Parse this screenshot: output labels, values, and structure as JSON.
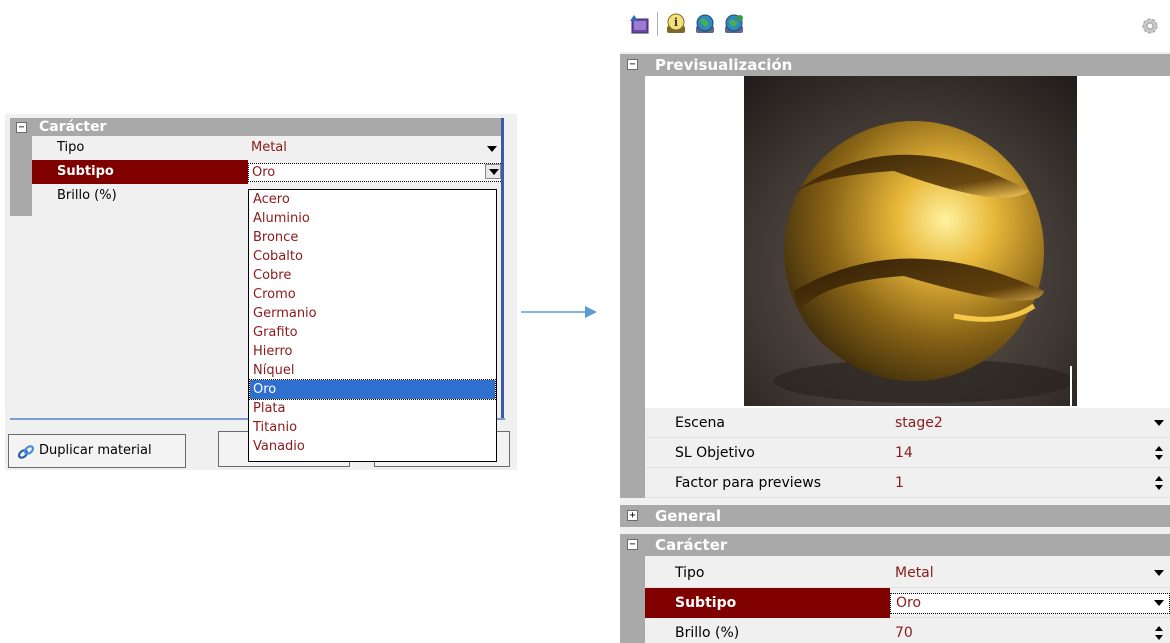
{
  "left": {
    "section_title": "Carácter",
    "collapse_glyph": "−",
    "rows": [
      {
        "label": "Tipo",
        "value": "Metal"
      },
      {
        "label": "Subtipo",
        "value": "Oro"
      },
      {
        "label": "Brillo (%)",
        "value": ""
      }
    ],
    "dropdown_options": [
      "Acero",
      "Aluminio",
      "Bronce",
      "Cobalto",
      "Cobre",
      "Cromo",
      "Germanio",
      "Grafito",
      "Hierro",
      "Níquel",
      "Oro",
      "Plata",
      "Titanio",
      "Vanadio"
    ],
    "selected_option": "Oro",
    "duplicate_button_label": "Duplicar material"
  },
  "right": {
    "toolbar_icons": [
      "import-icon",
      "info-icon",
      "globe-icon",
      "globe-refresh-icon",
      "settings-gear-icon"
    ],
    "preview": {
      "section_title": "Previsualización",
      "collapse_glyph": "−",
      "rows": [
        {
          "label": "Escena",
          "value": "stage2",
          "control": "dropdown"
        },
        {
          "label": "SL Objetivo",
          "value": "14",
          "control": "spinner"
        },
        {
          "label": "Factor para previews",
          "value": "1",
          "control": "spinner"
        }
      ]
    },
    "general": {
      "section_title": "General",
      "collapse_glyph": "+"
    },
    "caracter": {
      "section_title": "Carácter",
      "collapse_glyph": "−",
      "rows": [
        {
          "label": "Tipo",
          "value": "Metal",
          "control": "dropdown"
        },
        {
          "label": "Subtipo",
          "value": "Oro",
          "control": "dropdown"
        },
        {
          "label": "Brillo (%)",
          "value": "70",
          "control": "spinner"
        }
      ]
    }
  },
  "colors": {
    "header_gray": "#a9a9a9",
    "selected_row": "#800000",
    "value_text": "#8b1a1a",
    "list_highlight": "#2f6fd0",
    "arrow_blue": "#5b9bd5"
  }
}
